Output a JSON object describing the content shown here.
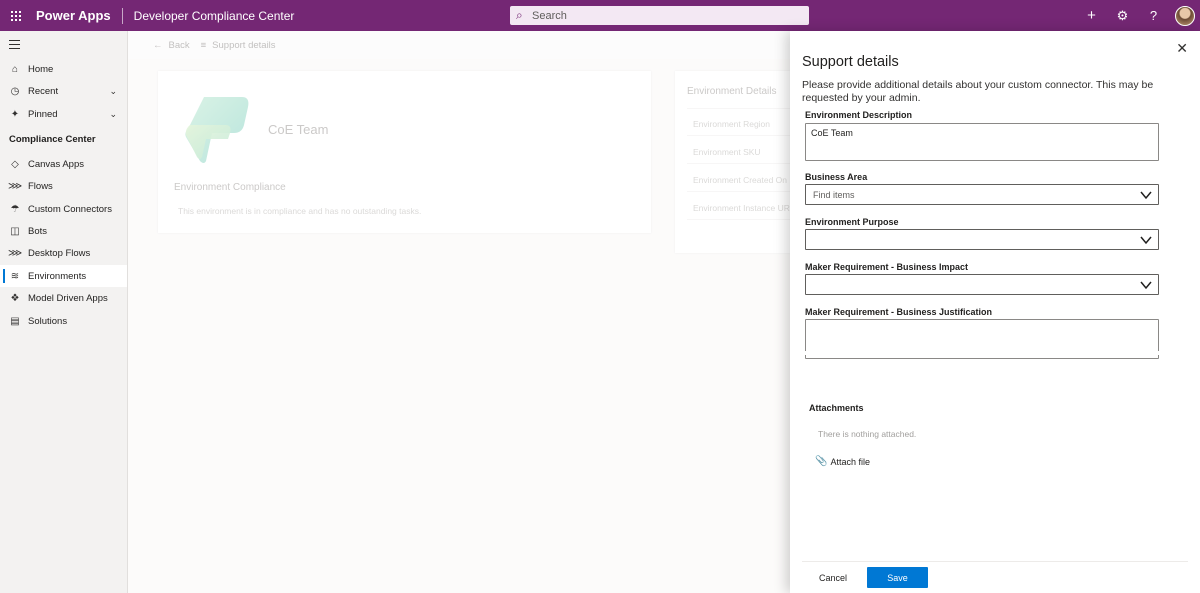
{
  "topbar": {
    "app_name": "Power Apps",
    "environment": "Developer Compliance Center",
    "search_placeholder": "Search",
    "brand_color": "#742774"
  },
  "sidebar": {
    "items": [
      {
        "label": "Home",
        "icon": "home-icon"
      },
      {
        "label": "Recent",
        "icon": "clock-icon"
      },
      {
        "label": "Pinned",
        "icon": "pin-icon"
      }
    ],
    "section_title": "Compliance Center",
    "section_items": [
      {
        "label": "Canvas Apps",
        "icon": "canvas-app-icon"
      },
      {
        "label": "Flows",
        "icon": "flow-icon"
      },
      {
        "label": "Custom Connectors",
        "icon": "connector-icon"
      },
      {
        "label": "Bots",
        "icon": "bot-icon"
      },
      {
        "label": "Desktop Flows",
        "icon": "desktop-flow-icon"
      },
      {
        "label": "Environments",
        "icon": "environment-icon",
        "active": true
      },
      {
        "label": "Model Driven Apps",
        "icon": "model-app-icon"
      },
      {
        "label": "Solutions",
        "icon": "solution-icon"
      }
    ]
  },
  "commandbar": {
    "back_label": "Back",
    "support_label": "Support details"
  },
  "env_card": {
    "title": "CoE Team",
    "compliance_heading": "Environment Compliance",
    "compliance_text": "This environment is in compliance and has no outstanding tasks."
  },
  "details_card": {
    "heading": "Environment Details",
    "rows": [
      "Environment Region",
      "Environment SKU",
      "Environment Created On",
      "Environment Instance URL"
    ]
  },
  "panel": {
    "title": "Support details",
    "description": "Please provide additional details about your custom connector. This may be requested by your admin.",
    "fields": {
      "env_description_label": "Environment Description",
      "env_description_value": "CoE Team",
      "business_area_label": "Business Area",
      "business_area_placeholder": "Find items",
      "env_purpose_label": "Environment Purpose",
      "env_purpose_value": "",
      "business_impact_label": "Maker Requirement - Business Impact",
      "business_impact_value": "",
      "business_justification_label": "Maker Requirement - Business Justification",
      "business_justification_value": ""
    },
    "attachments_label": "Attachments",
    "attachments_empty": "There is nothing attached.",
    "attach_button": "Attach file",
    "cancel_button": "Cancel",
    "save_button": "Save",
    "accent_color": "#0078d4"
  }
}
